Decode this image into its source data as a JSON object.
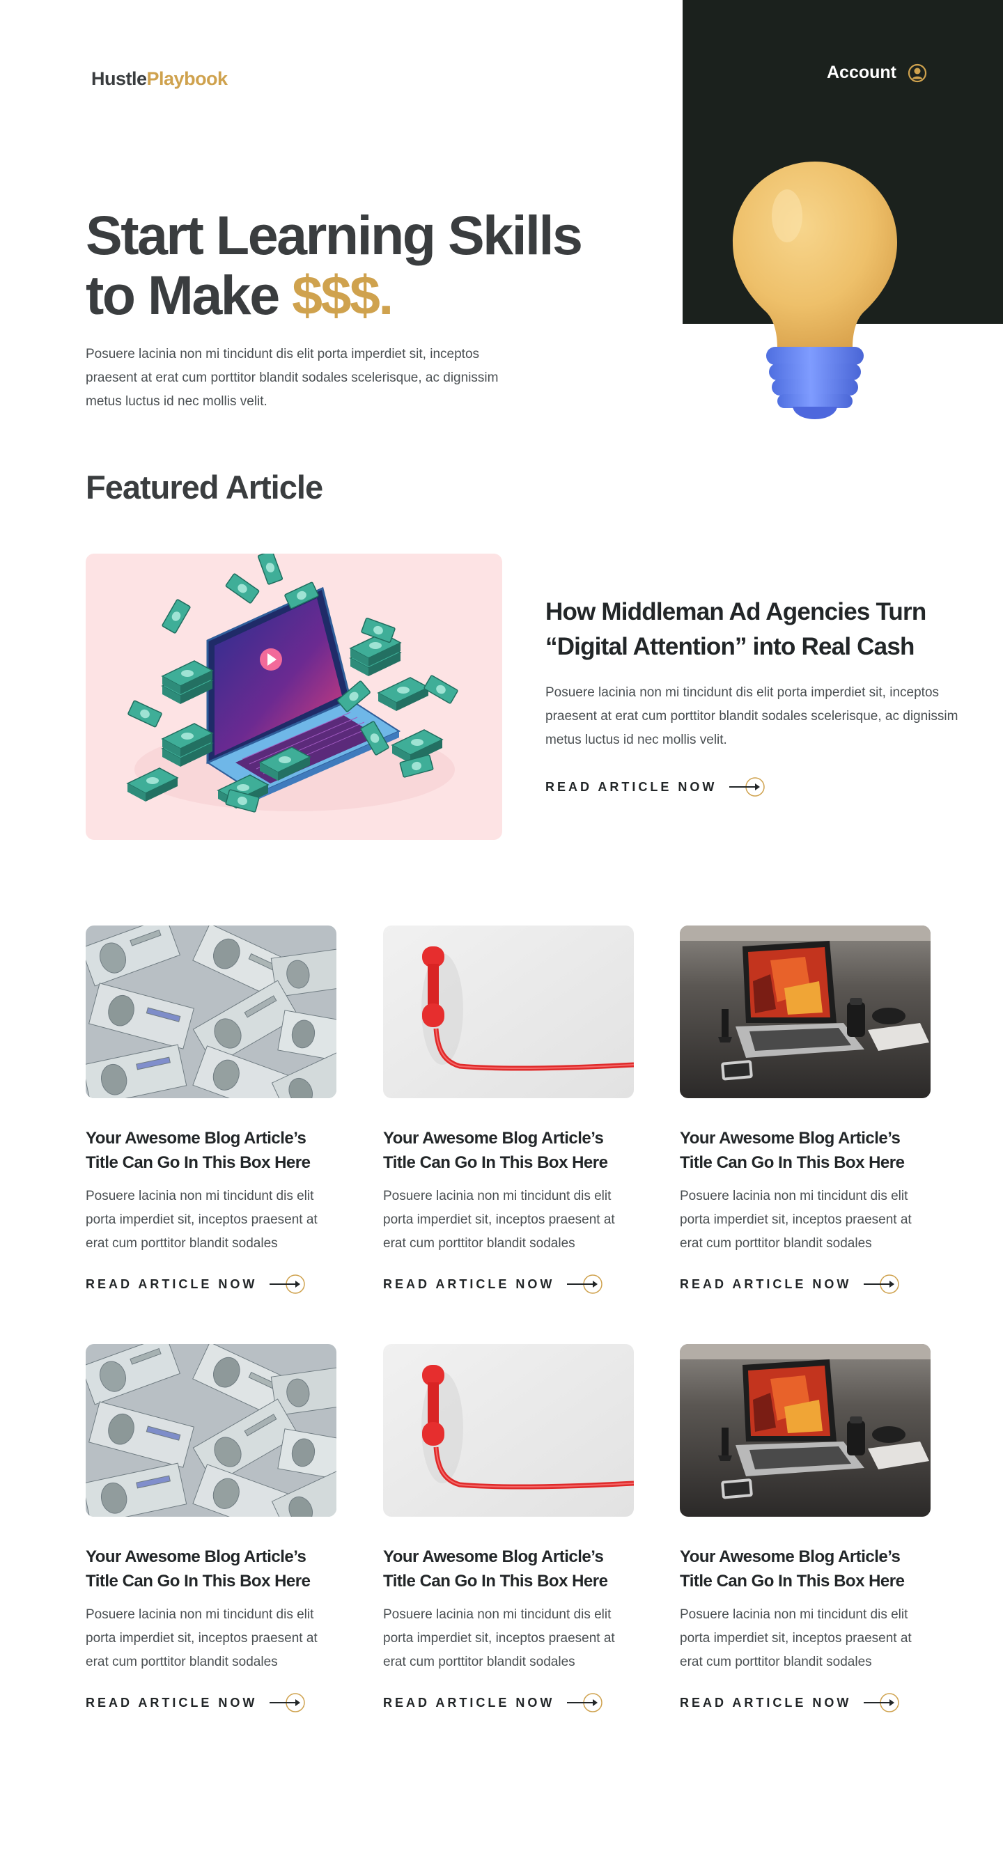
{
  "header": {
    "logo_part1": "Hustle",
    "logo_part2": "Playbook",
    "account_label": "Account",
    "account_icon": "user-circle-icon"
  },
  "hero": {
    "title_line1": "Start Learning Skills",
    "title_line2": "to Make ",
    "title_money": "$$$.",
    "description": "Posuere lacinia non mi tincidunt dis elit porta imperdiet sit, inceptos praesent at erat cum porttitor blandit sodales scelerisque, ac dignissim metus luctus id nec mollis velit.",
    "illustration": "lightbulb-illustration"
  },
  "featured": {
    "section_title": "Featured Article",
    "image": "laptop-with-money-illustration",
    "title": "How Middleman Ad Agencies Turn “Digital Attention” into Real Cash",
    "description": "Posuere lacinia non mi tincidunt dis elit porta imperdiet sit, inceptos praesent at erat cum porttitor blandit sodales scelerisque, ac dignissim metus luctus id nec mollis velit.",
    "cta": "READ ARTICLE NOW"
  },
  "articles": [
    {
      "image": "dollar-bills-photo",
      "title": "Your Awesome Blog Article’s Title Can Go In This Box Here",
      "excerpt": "Posuere lacinia non mi tincidunt dis elit porta imperdiet sit, inceptos praesent at erat cum porttitor blandit sodales",
      "cta": "READ ARTICLE NOW"
    },
    {
      "image": "red-telephone-photo",
      "title": "Your Awesome Blog Article’s Title Can Go In This Box Here",
      "excerpt": "Posuere lacinia non mi tincidunt dis elit porta imperdiet sit, inceptos praesent at erat cum porttitor blandit sodales",
      "cta": "READ ARTICLE NOW"
    },
    {
      "image": "laptop-desk-photo",
      "title": "Your Awesome Blog Article’s Title Can Go In This Box Here",
      "excerpt": "Posuere lacinia non mi tincidunt dis elit porta imperdiet sit, inceptos praesent at erat cum porttitor blandit sodales",
      "cta": "READ ARTICLE NOW"
    },
    {
      "image": "dollar-bills-photo",
      "title": "Your Awesome Blog Article’s Title Can Go In This Box Here",
      "excerpt": "Posuere lacinia non mi tincidunt dis elit porta imperdiet sit, inceptos praesent at erat cum porttitor blandit sodales",
      "cta": "READ ARTICLE NOW"
    },
    {
      "image": "red-telephone-photo",
      "title": "Your Awesome Blog Article’s Title Can Go In This Box Here",
      "excerpt": "Posuere lacinia non mi tincidunt dis elit porta imperdiet sit, inceptos praesent at erat cum porttitor blandit sodales",
      "cta": "READ ARTICLE NOW"
    },
    {
      "image": "laptop-desk-photo",
      "title": "Your Awesome Blog Article’s Title Can Go In This Box Here",
      "excerpt": "Posuere lacinia non mi tincidunt dis elit porta imperdiet sit, inceptos praesent at erat cum porttitor blandit sodales",
      "cta": "READ ARTICLE NOW"
    }
  ],
  "colors": {
    "accent": "#cfa24e",
    "dark_panel": "#1b211d",
    "heading": "#3a3d3f",
    "featured_bg": "#fde3e4"
  }
}
